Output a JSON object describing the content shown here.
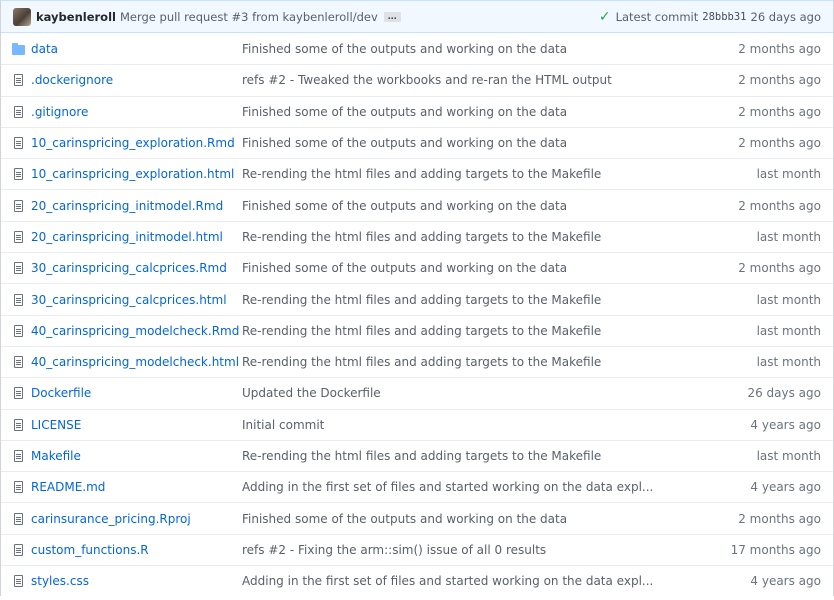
{
  "commit": {
    "author": "kaybenleroll",
    "message": "Merge pull request #3 from kaybenleroll/dev",
    "ellipsis": "…",
    "latest_label": "Latest commit",
    "sha": "28bbb31",
    "age": "26 days ago",
    "status_color": "#28a745"
  },
  "files": [
    {
      "name": "data",
      "type": "folder",
      "icon": "folder-icon",
      "message": "Finished some of the outputs and working on the data",
      "age": "2 months ago"
    },
    {
      "name": ".dockerignore",
      "type": "file",
      "icon": "file-icon",
      "message": "refs #2 - Tweaked the workbooks and re-ran the HTML output",
      "age": "2 months ago"
    },
    {
      "name": ".gitignore",
      "type": "file",
      "icon": "file-icon",
      "message": "Finished some of the outputs and working on the data",
      "age": "2 months ago"
    },
    {
      "name": "10_carinspricing_exploration.Rmd",
      "type": "file",
      "icon": "file-icon",
      "message": "Finished some of the outputs and working on the data",
      "age": "2 months ago"
    },
    {
      "name": "10_carinspricing_exploration.html",
      "type": "file",
      "icon": "file-icon",
      "message": "Re-rending the html files and adding targets to the Makefile",
      "age": "last month"
    },
    {
      "name": "20_carinspricing_initmodel.Rmd",
      "type": "file",
      "icon": "file-icon",
      "message": "Finished some of the outputs and working on the data",
      "age": "2 months ago"
    },
    {
      "name": "20_carinspricing_initmodel.html",
      "type": "file",
      "icon": "file-icon",
      "message": "Re-rending the html files and adding targets to the Makefile",
      "age": "last month"
    },
    {
      "name": "30_carinspricing_calcprices.Rmd",
      "type": "file",
      "icon": "file-icon",
      "message": "Finished some of the outputs and working on the data",
      "age": "2 months ago"
    },
    {
      "name": "30_carinspricing_calcprices.html",
      "type": "file",
      "icon": "file-icon",
      "message": "Re-rending the html files and adding targets to the Makefile",
      "age": "last month"
    },
    {
      "name": "40_carinspricing_modelcheck.Rmd",
      "type": "file",
      "icon": "file-icon",
      "message": "Re-rending the html files and adding targets to the Makefile",
      "age": "last month"
    },
    {
      "name": "40_carinspricing_modelcheck.html",
      "type": "file",
      "icon": "file-icon",
      "message": "Re-rending the html files and adding targets to the Makefile",
      "age": "last month"
    },
    {
      "name": "Dockerfile",
      "type": "file",
      "icon": "file-icon",
      "message": "Updated the Dockerfile",
      "age": "26 days ago"
    },
    {
      "name": "LICENSE",
      "type": "file",
      "icon": "file-icon",
      "message": "Initial commit",
      "age": "4 years ago"
    },
    {
      "name": "Makefile",
      "type": "file",
      "icon": "file-icon",
      "message": "Re-rending the html files and adding targets to the Makefile",
      "age": "last month"
    },
    {
      "name": "README.md",
      "type": "file",
      "icon": "file-icon",
      "message": "Adding in the first set of files and started working on the data expl...",
      "age": "4 years ago"
    },
    {
      "name": "carinsurance_pricing.Rproj",
      "type": "file",
      "icon": "file-icon",
      "message": "Finished some of the outputs and working on the data",
      "age": "2 months ago"
    },
    {
      "name": "custom_functions.R",
      "type": "file",
      "icon": "file-icon",
      "message": "refs #2 - Fixing the arm::sim() issue of all 0 results",
      "age": "17 months ago"
    },
    {
      "name": "styles.css",
      "type": "file",
      "icon": "file-icon",
      "message": "Adding in the first set of files and started working on the data expl...",
      "age": "4 years ago"
    }
  ]
}
